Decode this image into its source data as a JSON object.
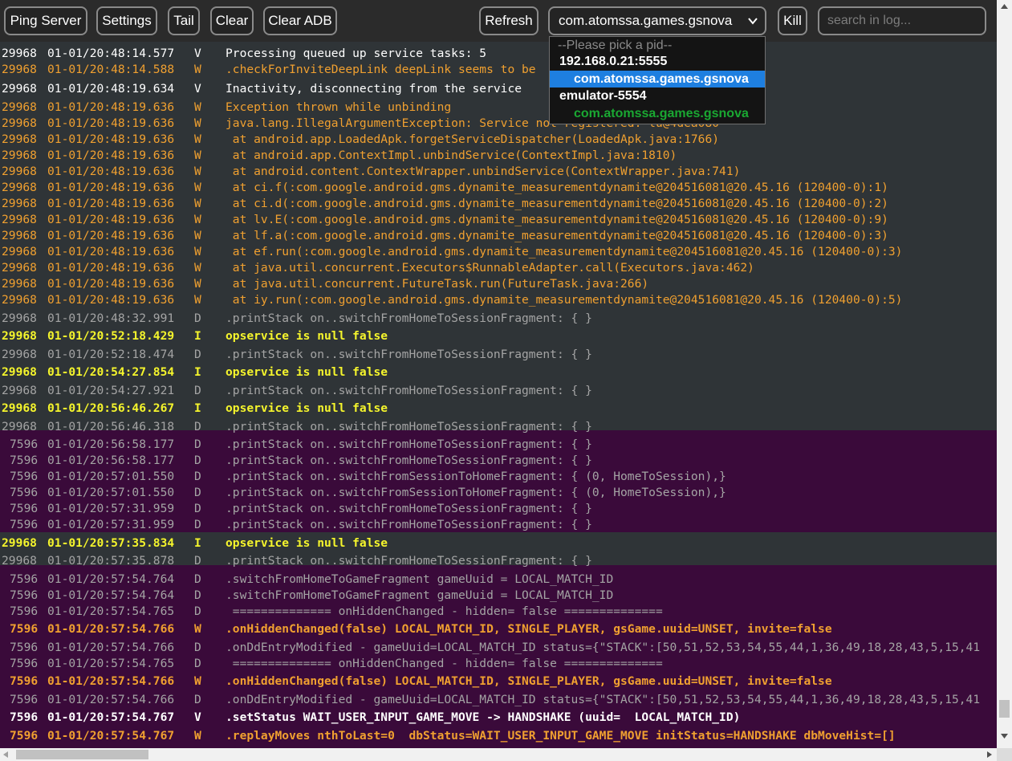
{
  "toolbar": {
    "ping_label": "Ping Server",
    "settings_label": "Settings",
    "tail_label": "Tail",
    "clear_label": "Clear",
    "clear_adb_label": "Clear ADB",
    "refresh_label": "Refresh",
    "pid_select_value": "com.atomssa.games.gsnova",
    "kill_label": "Kill",
    "search_placeholder": "search in log..."
  },
  "dropdown": {
    "placeholder": "--Please pick a pid--",
    "group1": "192.168.0.21:5555",
    "group1_option": "com.atomssa.games.gsnova",
    "group2": "emulator-5554",
    "group2_option": "com.atomssa.games.gsnova"
  },
  "log": {
    "rows": [
      {
        "pid": "29968",
        "time": "01-01/20:48:14.577",
        "level": "V",
        "msg": "Processing queued up service tasks: 5"
      },
      {
        "pid": "29968",
        "time": "01-01/20:48:14.588",
        "level": "W",
        "msg": ".checkForInviteDeepLink deepLink seems to be"
      },
      {
        "pid": "29968",
        "time": "01-01/20:48:19.634",
        "level": "V",
        "msg": "Inactivity, disconnecting from the service"
      },
      {
        "pid": "29968",
        "time": "01-01/20:48:19.636",
        "level": "W",
        "msg": "Exception thrown while unbinding"
      },
      {
        "pid": "29968",
        "time": "01-01/20:48:19.636",
        "level": "W",
        "msg": "java.lang.IllegalArgumentException: Service not registered: lu@4dea080"
      },
      {
        "pid": "29968",
        "time": "01-01/20:48:19.636",
        "level": "W",
        "msg": " at android.app.LoadedApk.forgetServiceDispatcher(LoadedApk.java:1766)"
      },
      {
        "pid": "29968",
        "time": "01-01/20:48:19.636",
        "level": "W",
        "msg": " at android.app.ContextImpl.unbindService(ContextImpl.java:1810)"
      },
      {
        "pid": "29968",
        "time": "01-01/20:48:19.636",
        "level": "W",
        "msg": " at android.content.ContextWrapper.unbindService(ContextWrapper.java:741)"
      },
      {
        "pid": "29968",
        "time": "01-01/20:48:19.636",
        "level": "W",
        "msg": " at ci.f(:com.google.android.gms.dynamite_measurementdynamite@204516081@20.45.16 (120400-0):1)"
      },
      {
        "pid": "29968",
        "time": "01-01/20:48:19.636",
        "level": "W",
        "msg": " at ci.d(:com.google.android.gms.dynamite_measurementdynamite@204516081@20.45.16 (120400-0):2)"
      },
      {
        "pid": "29968",
        "time": "01-01/20:48:19.636",
        "level": "W",
        "msg": " at lv.E(:com.google.android.gms.dynamite_measurementdynamite@204516081@20.45.16 (120400-0):9)"
      },
      {
        "pid": "29968",
        "time": "01-01/20:48:19.636",
        "level": "W",
        "msg": " at lf.a(:com.google.android.gms.dynamite_measurementdynamite@204516081@20.45.16 (120400-0):3)"
      },
      {
        "pid": "29968",
        "time": "01-01/20:48:19.636",
        "level": "W",
        "msg": " at ef.run(:com.google.android.gms.dynamite_measurementdynamite@204516081@20.45.16 (120400-0):3)"
      },
      {
        "pid": "29968",
        "time": "01-01/20:48:19.636",
        "level": "W",
        "msg": " at java.util.concurrent.Executors$RunnableAdapter.call(Executors.java:462)"
      },
      {
        "pid": "29968",
        "time": "01-01/20:48:19.636",
        "level": "W",
        "msg": " at java.util.concurrent.FutureTask.run(FutureTask.java:266)"
      },
      {
        "pid": "29968",
        "time": "01-01/20:48:19.636",
        "level": "W",
        "msg": " at iy.run(:com.google.android.gms.dynamite_measurementdynamite@204516081@20.45.16 (120400-0):5)"
      },
      {
        "pid": "29968",
        "time": "01-01/20:48:32.991",
        "level": "D",
        "msg": ".printStack on..switchFromHomeToSessionFragment: { }"
      },
      {
        "pid": "29968",
        "time": "01-01/20:52:18.429",
        "level": "I",
        "msg": "opservice is null false"
      },
      {
        "pid": "29968",
        "time": "01-01/20:52:18.474",
        "level": "D",
        "msg": ".printStack on..switchFromHomeToSessionFragment: { }"
      },
      {
        "pid": "29968",
        "time": "01-01/20:54:27.854",
        "level": "I",
        "msg": "opservice is null false"
      },
      {
        "pid": "29968",
        "time": "01-01/20:54:27.921",
        "level": "D",
        "msg": ".printStack on..switchFromHomeToSessionFragment: { }"
      },
      {
        "pid": "29968",
        "time": "01-01/20:56:46.267",
        "level": "I",
        "msg": "opservice is null false"
      },
      {
        "pid": "29968",
        "time": "01-01/20:56:46.318",
        "level": "D",
        "msg": ".printStack on..switchFromHomeToSessionFragment: { }"
      },
      {
        "pid": "7596",
        "time": "01-01/20:56:58.177",
        "level": "D",
        "msg": ".printStack on..switchFromHomeToSessionFragment: { }"
      },
      {
        "pid": "7596",
        "time": "01-01/20:56:58.177",
        "level": "D",
        "msg": ".printStack on..switchFromHomeToSessionFragment: { }"
      },
      {
        "pid": "7596",
        "time": "01-01/20:57:01.550",
        "level": "D",
        "msg": ".printStack on..switchFromSessionToHomeFragment: { (0, HomeToSession),}"
      },
      {
        "pid": "7596",
        "time": "01-01/20:57:01.550",
        "level": "D",
        "msg": ".printStack on..switchFromSessionToHomeFragment: { (0, HomeToSession),}"
      },
      {
        "pid": "7596",
        "time": "01-01/20:57:31.959",
        "level": "D",
        "msg": ".printStack on..switchFromHomeToSessionFragment: { }"
      },
      {
        "pid": "7596",
        "time": "01-01/20:57:31.959",
        "level": "D",
        "msg": ".printStack on..switchFromHomeToSessionFragment: { }"
      },
      {
        "pid": "29968",
        "time": "01-01/20:57:35.834",
        "level": "I",
        "msg": "opservice is null false"
      },
      {
        "pid": "29968",
        "time": "01-01/20:57:35.878",
        "level": "D",
        "msg": ".printStack on..switchFromHomeToSessionFragment: { }"
      },
      {
        "pid": "7596",
        "time": "01-01/20:57:54.764",
        "level": "D",
        "msg": ".switchFromHomeToGameFragment gameUuid = LOCAL_MATCH_ID"
      },
      {
        "pid": "7596",
        "time": "01-01/20:57:54.764",
        "level": "D",
        "msg": ".switchFromHomeToGameFragment gameUuid = LOCAL_MATCH_ID"
      },
      {
        "pid": "7596",
        "time": "01-01/20:57:54.765",
        "level": "D",
        "msg": " ============== onHiddenChanged - hidden= false =============="
      },
      {
        "pid": "7596",
        "time": "01-01/20:57:54.766",
        "level": "W",
        "msg": ".onHiddenChanged(false) LOCAL_MATCH_ID, SINGLE_PLAYER, gsGame.uuid=UNSET, invite=false"
      },
      {
        "pid": "7596",
        "time": "01-01/20:57:54.766",
        "level": "D",
        "msg": ".onDdEntryModified - gameUuid=LOCAL_MATCH_ID status={\"STACK\":[50,51,52,53,54,55,44,1,36,49,18,28,43,5,15,41"
      },
      {
        "pid": "7596",
        "time": "01-01/20:57:54.765",
        "level": "D",
        "msg": " ============== onHiddenChanged - hidden= false =============="
      },
      {
        "pid": "7596",
        "time": "01-01/20:57:54.766",
        "level": "W",
        "msg": ".onHiddenChanged(false) LOCAL_MATCH_ID, SINGLE_PLAYER, gsGame.uuid=UNSET, invite=false"
      },
      {
        "pid": "7596",
        "time": "01-01/20:57:54.766",
        "level": "D",
        "msg": ".onDdEntryModified - gameUuid=LOCAL_MATCH_ID status={\"STACK\":[50,51,52,53,54,55,44,1,36,49,18,28,43,5,15,41"
      },
      {
        "pid": "7596",
        "time": "01-01/20:57:54.767",
        "level": "V",
        "msg": ".setStatus WAIT_USER_INPUT_GAME_MOVE -> HANDSHAKE (uuid=  LOCAL_MATCH_ID)"
      },
      {
        "pid": "7596",
        "time": "01-01/20:57:54.767",
        "level": "W",
        "msg": ".replayMoves nthToLast=0  dbStatus=WAIT_USER_INPUT_GAME_MOVE initStatus=HANDSHAKE dbMoveHist=[]"
      }
    ]
  },
  "colors": {
    "bg_app": "#2f3437",
    "bg_pid_7596": "#3a0a3a",
    "level_V": "#ffffff",
    "level_W": "#f0a030",
    "level_D": "#a4a4a4",
    "level_I": "#f5f52c",
    "dropdown_selected": "#1e7fe0",
    "dropdown_emulator_option": "#1aa832"
  }
}
